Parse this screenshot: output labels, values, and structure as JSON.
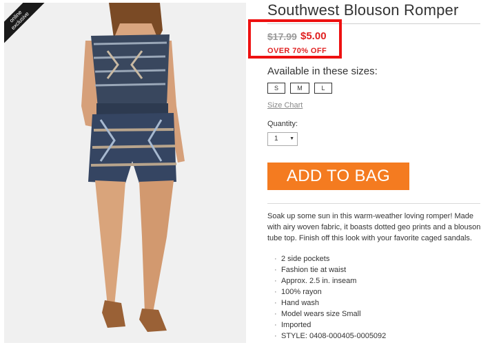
{
  "product": {
    "title": "Southwest Blouson Romper",
    "badge": {
      "line1": "online",
      "line2": "exclusive"
    },
    "price": {
      "original": "$17.99",
      "sale": "$5.00",
      "discount": "OVER 70% OFF"
    },
    "sizes_label": "Available in these sizes:",
    "sizes": [
      "S",
      "M",
      "L"
    ],
    "size_chart": "Size Chart",
    "quantity": {
      "label": "Quantity:",
      "value": "1"
    },
    "add_to_bag": "ADD TO BAG",
    "description": "Soak up some sun in this warm-weather loving romper! Made with airy woven fabric, it boasts dotted geo prints and a blouson tube top. Finish off this look with your favorite caged sandals.",
    "features": [
      "2 side pockets",
      "Fashion tie at waist",
      "Approx. 2.5 in. inseam",
      "100% rayon",
      "Hand wash",
      "Model wears size Small",
      "Imported",
      "STYLE: 0408-000405-0005092"
    ]
  },
  "colors": {
    "accent": "#f47b20",
    "sale": "#e02020",
    "highlight_box": "#ee1111"
  }
}
